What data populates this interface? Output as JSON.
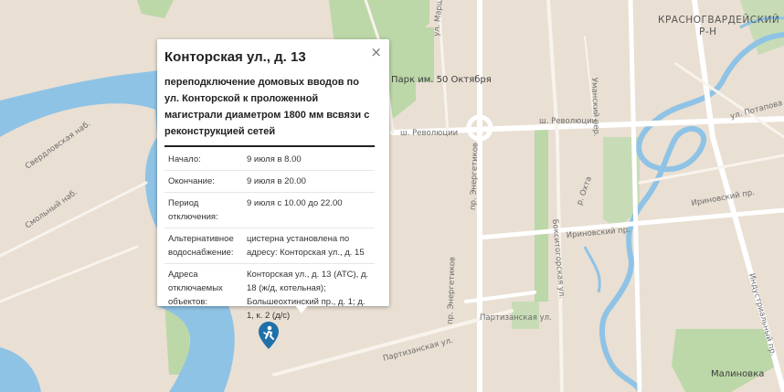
{
  "map": {
    "colors": {
      "land": "#e9dfd3",
      "water": "#8fc3e6",
      "park": "#bcd7a8",
      "road_major": "#ffffff",
      "road_minor": "#f6f1ea"
    },
    "labels": {
      "district": "КРАСНОГВАРДЕЙСКИЙ",
      "district_sub": "Р-Н",
      "park": "Парк им. 50 Октября",
      "revolution_west": "ш. Революции",
      "revolution_east": "ш. Революции",
      "irinovsky1": "Ириновский пр.",
      "irinovsky2": "Ириновский пр.",
      "industrialny": "Индустриальный пр.",
      "marshal": "ул. Маршала Тухачевского",
      "energetikov": "пр. Энергетиков",
      "partizanskaya": "Партизанская ул.",
      "okhta": "р. Охта",
      "potapova": "ул. Потапова",
      "malinovka": "Малиновка",
      "umanskiy": "Уманский пер.",
      "bokseg": "Бокситогорская ул.",
      "sverdlovskaya": "Свердловская наб.",
      "smolny": "Смольный наб."
    }
  },
  "popup": {
    "close_symbol": "×",
    "title": "Конторская ул., д. 13",
    "description": "переподключение домовых вводов по ул. Конторской к проложенной магистрали диаметром 1800 мм всвязи с реконструкцией сетей",
    "rows": [
      {
        "key": "Начало:",
        "value": "9 июля в 8.00"
      },
      {
        "key": "Окончание:",
        "value": "9 июля в 20.00"
      },
      {
        "key": "Период отключения:",
        "value": "9 июля с 10.00 до 22.00"
      },
      {
        "key": "Альтернативное водоснабжение:",
        "value": "цистерна установлена по адресу: Конторская ул., д. 15"
      },
      {
        "key": "Адреса отключаемых объектов:",
        "value": "Конторская ул., д. 13 (АТС), д. 18 (ж/д, котельная); Большеохтинский пр., д. 1; д. 1, к. 2 (д/с)"
      }
    ]
  },
  "marker": {
    "icon": "worker-icon",
    "color": "#1f6fa8"
  }
}
